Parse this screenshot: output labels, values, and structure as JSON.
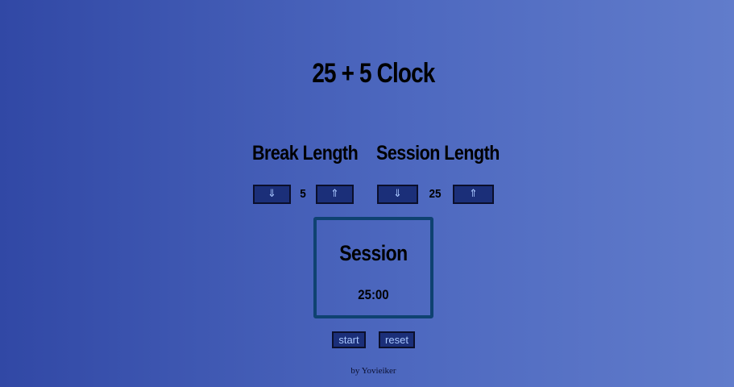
{
  "app": {
    "title": "25 + 5 Clock"
  },
  "break": {
    "label": "Break Length",
    "length": "5",
    "decrement_label": "⇓",
    "increment_label": "⇑",
    "decrement_icon": "double-arrow-down-icon",
    "increment_icon": "double-arrow-up-icon"
  },
  "session": {
    "label": "Session Length",
    "length": "25",
    "decrement_label": "⇓",
    "increment_label": "⇑",
    "decrement_icon": "double-arrow-down-icon",
    "increment_icon": "double-arrow-up-icon"
  },
  "timer": {
    "label": "Session",
    "time_left": "25:00"
  },
  "controls": {
    "start_label": "start",
    "reset_label": "reset"
  },
  "footer": {
    "credit": "by Yovieiker"
  },
  "colors": {
    "background_start": "#3148a5",
    "background_end": "#617ccb",
    "button_bg": "#1b2f79",
    "button_text": "#a9c7ff",
    "timer_border": "#0f4271"
  }
}
